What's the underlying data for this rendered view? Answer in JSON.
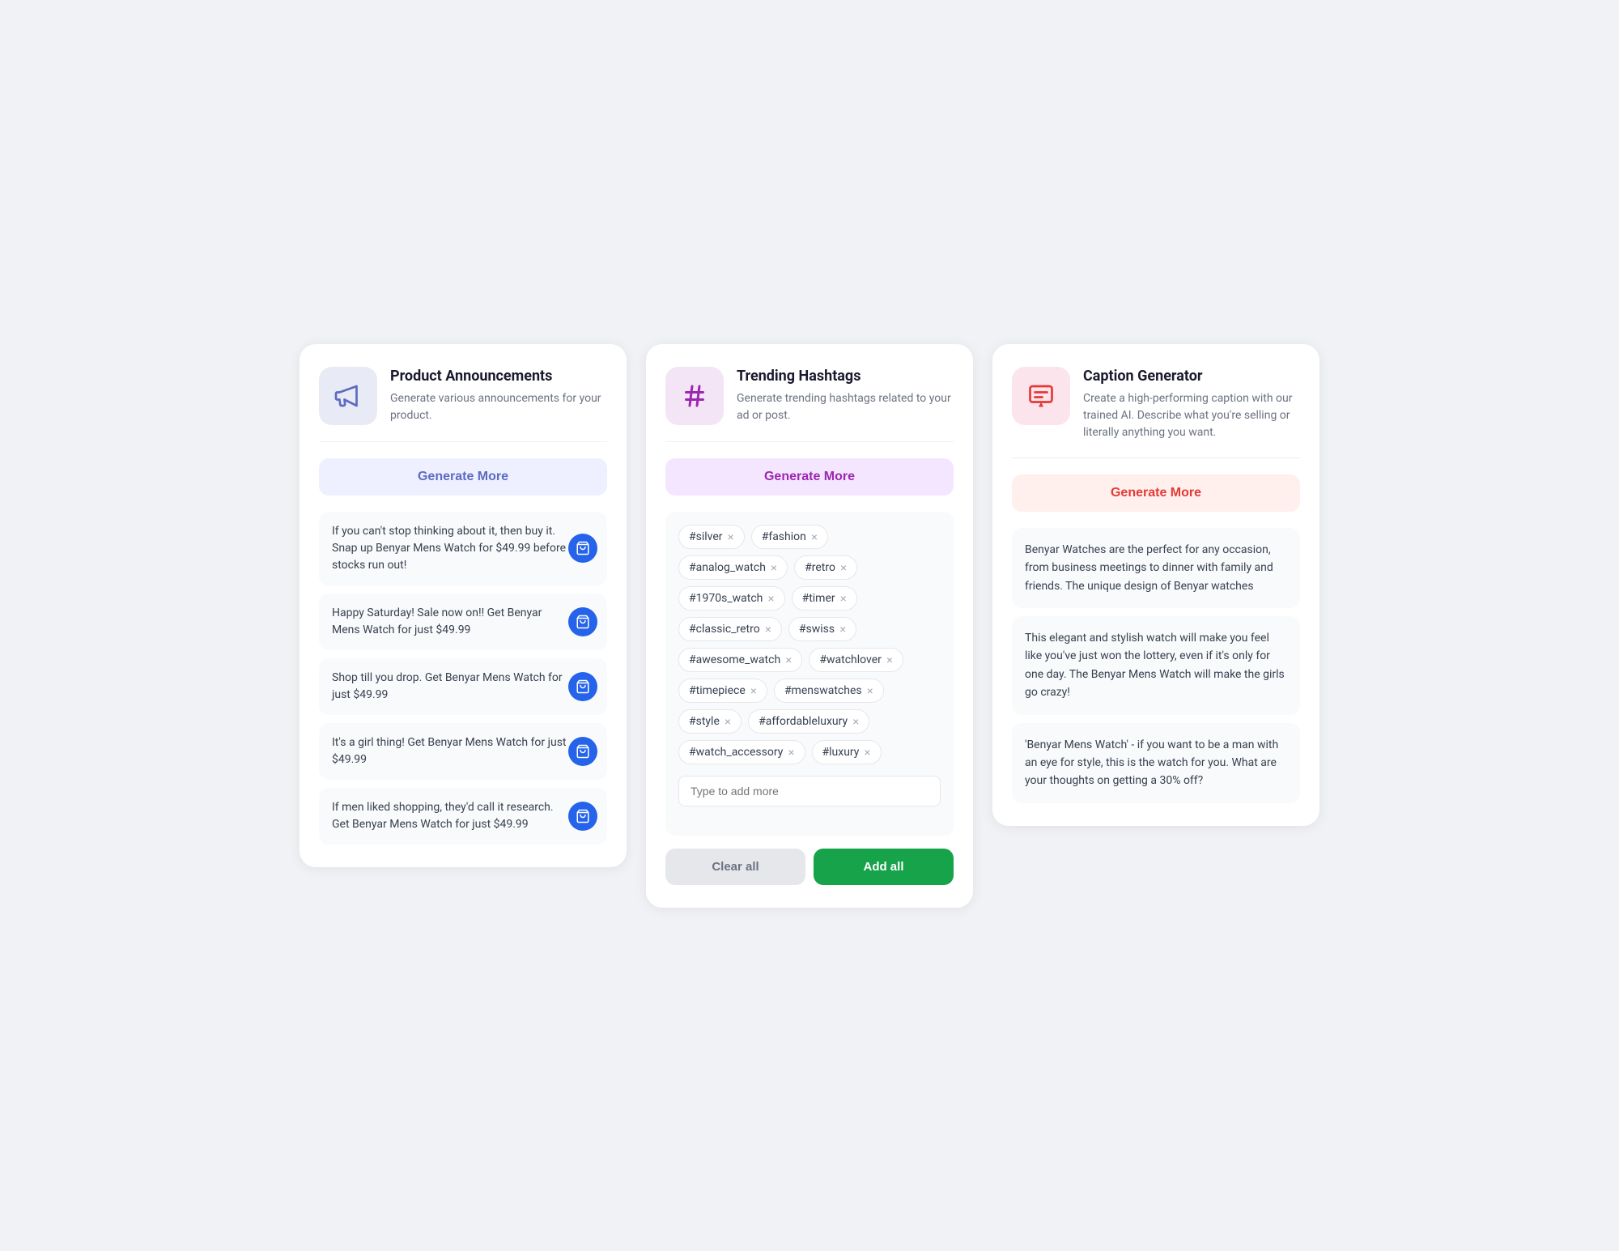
{
  "cards": [
    {
      "id": "product-announcements",
      "icon_type": "megaphone",
      "icon_color": "blue",
      "title": "Product Announcements",
      "description": "Generate various announcements for your product.",
      "generate_btn_label": "Generate More",
      "generate_btn_color": "blue",
      "announcements": [
        "If you can't stop thinking about it, then buy it. Snap up Benyar Mens Watch for $49.99 before stocks run out!",
        "Happy Saturday! Sale now on!! Get Benyar Mens Watch for just $49.99",
        "Shop till you drop. Get Benyar Mens Watch for just $49.99",
        "It's a girl thing! Get Benyar Mens Watch for just $49.99",
        "If men liked shopping, they'd call it research. Get Benyar Mens Watch for just $49.99"
      ]
    },
    {
      "id": "trending-hashtags",
      "icon_type": "hashtag",
      "icon_color": "purple",
      "title": "Trending Hashtags",
      "description": "Generate trending hashtags related to your ad or post.",
      "generate_btn_label": "Generate More",
      "generate_btn_color": "purple",
      "hashtags": [
        "#silver",
        "#fashion",
        "#analog_watch",
        "#retro",
        "#1970s_watch",
        "#timer",
        "#classic_retro",
        "#swiss",
        "#awesome_watch",
        "#watchlover",
        "#timepiece",
        "#menswatches",
        "#style",
        "#affordableluxury",
        "#watch_accessory",
        "#luxury"
      ],
      "type_placeholder": "Type to add more",
      "clear_label": "Clear all",
      "add_all_label": "Add all"
    },
    {
      "id": "caption-generator",
      "icon_type": "caption",
      "icon_color": "red",
      "title": "Caption Generator",
      "description": "Create a high-performing caption with our trained AI. Describe what you're selling or literally anything you want.",
      "generate_btn_label": "Generate More",
      "generate_btn_color": "red",
      "captions": [
        "Benyar Watches are the perfect for any occasion, from business meetings to dinner with family and friends. The unique design of Benyar watches",
        "This elegant and stylish watch will make you feel like you've just won the lottery, even if it's only for one day. The Benyar Mens Watch will make the girls go crazy!",
        "'Benyar Mens Watch' - if you want to be a man with an eye for style, this is the watch for you. What are your thoughts on getting a 30% off?"
      ]
    }
  ]
}
